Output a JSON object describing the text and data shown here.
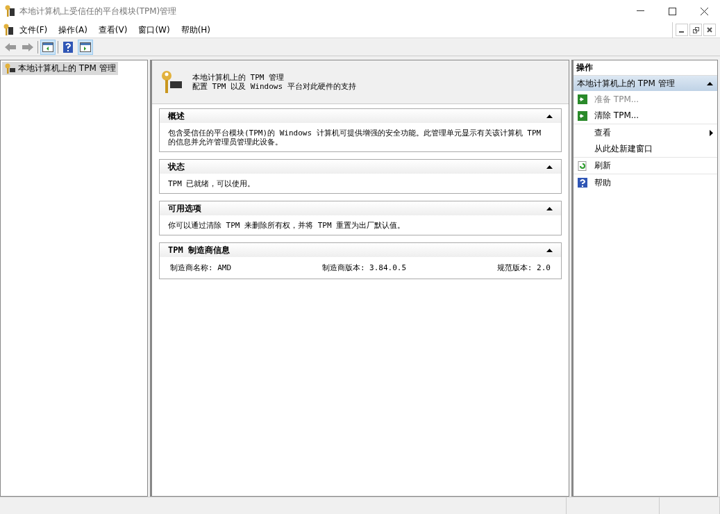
{
  "window": {
    "title": "本地计算机上受信任的平台模块(TPM)管理"
  },
  "menu": [
    "文件(F)",
    "操作(A)",
    "查看(V)",
    "窗口(W)",
    "帮助(H)"
  ],
  "tree": [
    {
      "label": "本地计算机上的 TPM 管理",
      "selected": true
    }
  ],
  "header": {
    "title": "本地计算机上的 TPM 管理",
    "subtitle": "配置 TPM 以及 Windows 平台对此硬件的支持"
  },
  "sections": [
    {
      "kind": "text",
      "title": "概述",
      "expanded": true,
      "text": "包含受信任的平台模块(TPM)的 Windows 计算机可提供增强的安全功能。此管理单元显示有关该计算机 TPM 的信息并允许管理员管理此设备。"
    },
    {
      "kind": "text",
      "title": "状态",
      "expanded": true,
      "text": "TPM 已就绪，可以使用。"
    },
    {
      "kind": "text",
      "title": "可用选项",
      "expanded": true,
      "text": "你可以通过清除 TPM 来删除所有权，并将 TPM 重置为出厂默认值。"
    },
    {
      "kind": "fields",
      "title": "TPM 制造商信息",
      "expanded": true,
      "fields": [
        "制造商名称: AMD",
        "制造商版本: 3.84.0.5",
        "规范版本: 2.0"
      ]
    }
  ],
  "actions": {
    "heading": "操作",
    "group": {
      "title": "本地计算机上的 TPM 管理",
      "expanded": true
    },
    "items": [
      {
        "kind": "run",
        "label": "准备 TPM...",
        "disabled": true,
        "submenu": false,
        "divider": false
      },
      {
        "kind": "run",
        "label": "清除 TPM...",
        "disabled": false,
        "submenu": false,
        "divider": true
      },
      {
        "kind": "plain",
        "label": "查看",
        "disabled": false,
        "submenu": true,
        "divider": false
      },
      {
        "kind": "plain",
        "label": "从此处新建窗口",
        "disabled": false,
        "submenu": false,
        "divider": true
      },
      {
        "kind": "refresh",
        "label": "刷新",
        "disabled": false,
        "submenu": false,
        "divider": true
      },
      {
        "kind": "help",
        "label": "帮助",
        "disabled": false,
        "submenu": false,
        "divider": false
      }
    ]
  }
}
